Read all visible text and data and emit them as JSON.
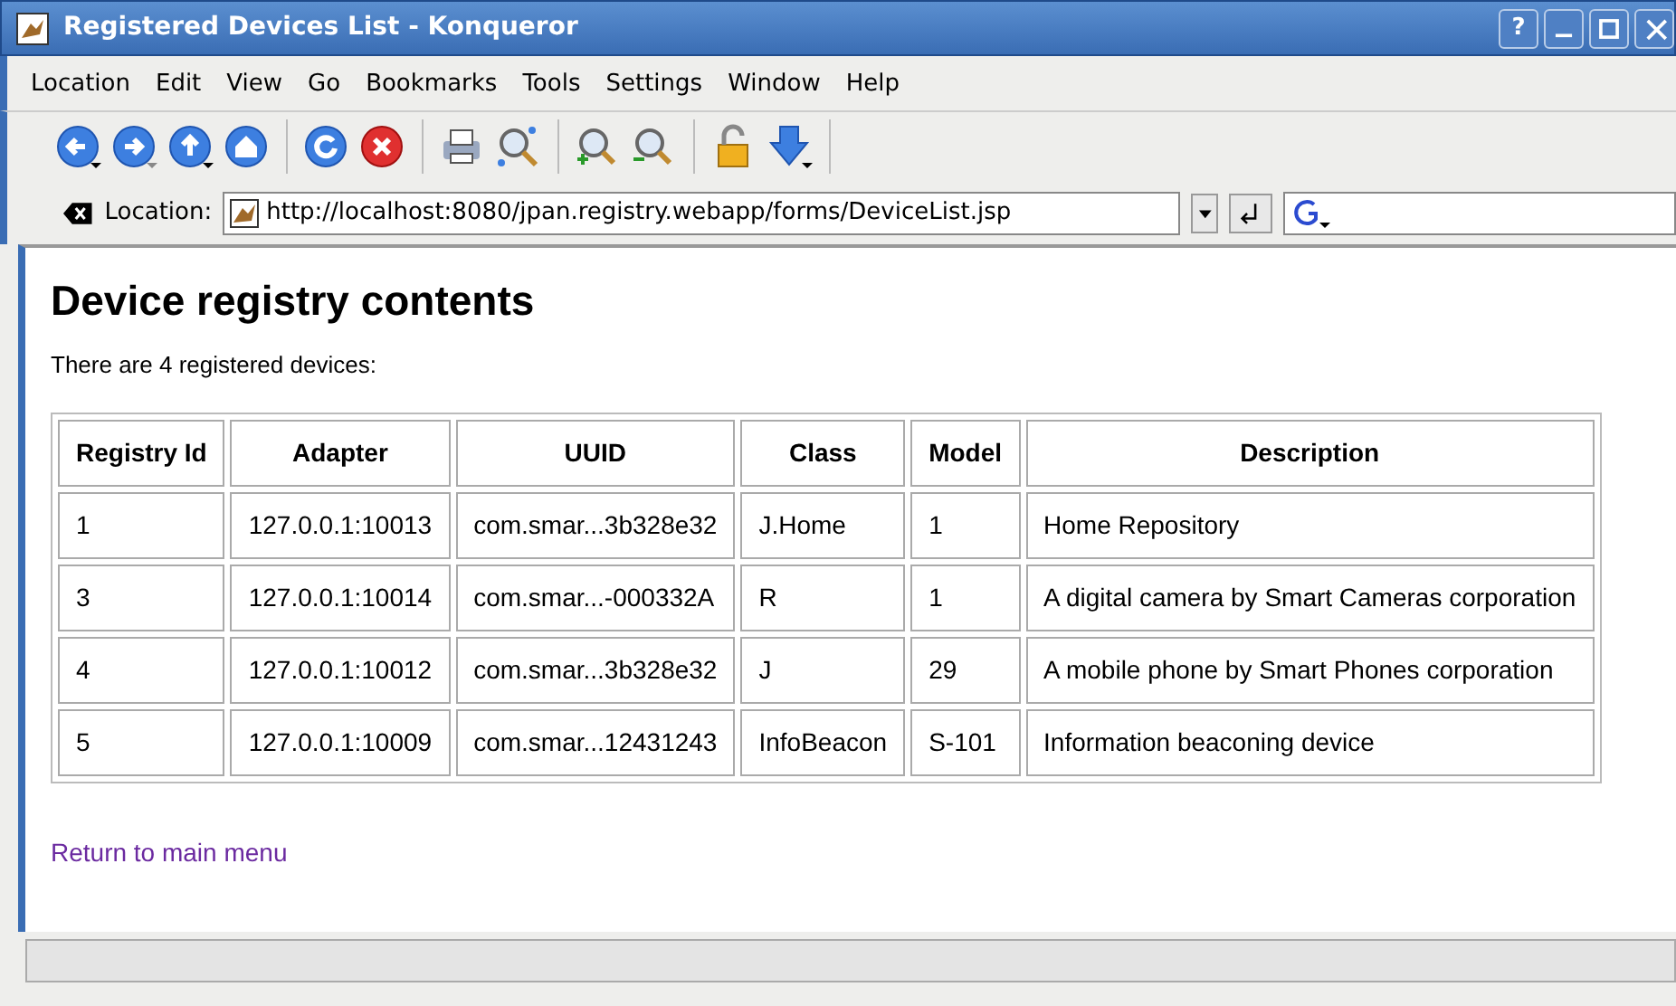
{
  "window": {
    "title": "Registered Devices List - Konqueror",
    "help_button": "?"
  },
  "menu": [
    "Location",
    "Edit",
    "View",
    "Go",
    "Bookmarks",
    "Tools",
    "Settings",
    "Window",
    "Help"
  ],
  "location_bar": {
    "label": "Location:",
    "url": "http://localhost:8080/jpan.registry.webapp/forms/DeviceList.jsp"
  },
  "page": {
    "heading": "Device registry contents",
    "summary": "There are 4 registered devices:",
    "table": {
      "columns": [
        "Registry Id",
        "Adapter",
        "UUID",
        "Class",
        "Model",
        "Description"
      ],
      "rows": [
        [
          "1",
          "127.0.0.1:10013",
          "com.smar...3b328e32",
          "J.Home",
          "1",
          "Home Repository"
        ],
        [
          "3",
          "127.0.0.1:10014",
          "com.smar...-000332A",
          "R",
          "1",
          "A digital camera by Smart Cameras corporation"
        ],
        [
          "4",
          "127.0.0.1:10012",
          "com.smar...3b328e32",
          "J",
          "29",
          "A mobile phone by Smart Phones corporation"
        ],
        [
          "5",
          "127.0.0.1:10009",
          "com.smar...12431243",
          "InfoBeacon",
          "S-101",
          "Information beaconing device"
        ]
      ]
    },
    "link": "Return to main menu"
  }
}
